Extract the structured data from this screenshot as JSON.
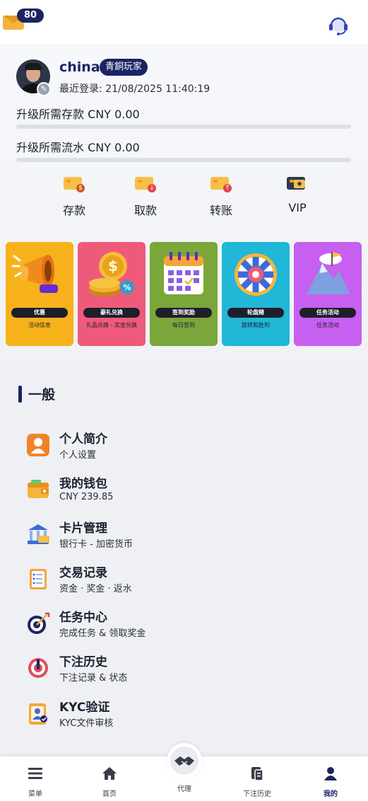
{
  "header": {
    "mail_badge": "80",
    "mail_icon": "mail-icon",
    "support_icon": "headset-support-icon"
  },
  "profile": {
    "username": "china",
    "tier": "青銅玩家",
    "last_login": "最近登录: 21/08/2025 11:40:19",
    "deposit_requirement": "升级所需存款 CNY 0.00",
    "deposit_progress": 0,
    "turnover_requirement": "升级所需流水 CNY 0.00",
    "turnover_progress": 0
  },
  "actions": [
    {
      "label": "存款",
      "icon": "deposit-icon"
    },
    {
      "label": "取款",
      "icon": "withdraw-icon"
    },
    {
      "label": "转账",
      "icon": "transfer-icon"
    },
    {
      "label": "VIP",
      "icon": "vip-icon"
    }
  ],
  "promos": [
    {
      "title": "优惠",
      "subtitle": "活动信息",
      "color": "#f7b21b"
    },
    {
      "title": "豪礼兑换",
      "subtitle": "礼品兑换 - 奖金兑换",
      "color": "#ef5a7a"
    },
    {
      "title": "签到奖励",
      "subtitle": "每日签到",
      "color": "#7aa63a"
    },
    {
      "title": "轮盘赌",
      "subtitle": "旋转和胜利",
      "color": "#21b7d6"
    },
    {
      "title": "任务活动",
      "subtitle": "任务活动",
      "color": "#c75ff0"
    }
  ],
  "section": {
    "title": "一般"
  },
  "menu": [
    {
      "title": "个人简介",
      "subtitle": "个人设置",
      "icon": "profile-icon"
    },
    {
      "title": "我的钱包",
      "subtitle": "CNY 239.85",
      "icon": "wallet-icon"
    },
    {
      "title": "卡片管理",
      "subtitle": "银行卡 - 加密货币",
      "icon": "bank-card-icon"
    },
    {
      "title": "交易记录",
      "subtitle": "资金 · 奖金 · 返水",
      "icon": "transaction-record-icon"
    },
    {
      "title": "任务中心",
      "subtitle": "完成任务 & 领取奖金",
      "icon": "mission-target-icon"
    },
    {
      "title": "下注历史",
      "subtitle": "下注记录 & 状态",
      "icon": "bet-history-icon"
    },
    {
      "title": "KYC验证",
      "subtitle": "KYC文件审核",
      "icon": "kyc-icon"
    }
  ],
  "nav": [
    {
      "label": "菜单",
      "icon": "menu-icon"
    },
    {
      "label": "首页",
      "icon": "home-icon"
    },
    {
      "label": "代理",
      "icon": "handshake-icon"
    },
    {
      "label": "下注历史",
      "icon": "bet-history-icon"
    },
    {
      "label": "我的",
      "icon": "user-icon"
    }
  ],
  "active_nav": "我的"
}
